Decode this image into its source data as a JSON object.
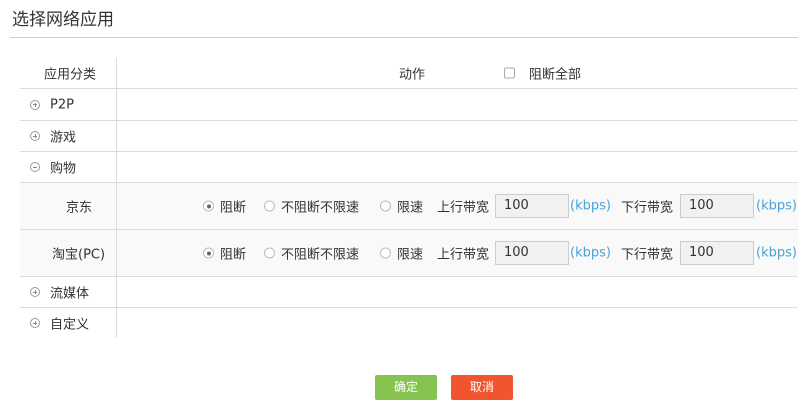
{
  "page": {
    "title": "选择网络应用"
  },
  "table": {
    "header": {
      "category": "应用分类",
      "action": "动作",
      "block_all_label": "阻断全部",
      "block_all_checked": false
    },
    "categories": [
      {
        "label": "P2P",
        "expanded": false
      },
      {
        "label": "游戏",
        "expanded": false
      },
      {
        "label": "购物",
        "expanded": true
      },
      {
        "label": "流媒体",
        "expanded": false
      },
      {
        "label": "自定义",
        "expanded": false
      }
    ],
    "shopping_apps": [
      {
        "name": "京东",
        "options": [
          "阻断",
          "不阻断不限速",
          "限速"
        ],
        "selected": "阻断",
        "upload_label": "上行带宽",
        "upload_value": "100",
        "download_label": "下行带宽",
        "download_value": "100",
        "unit": "(kbps)"
      },
      {
        "name": "淘宝(PC)",
        "options": [
          "阻断",
          "不阻断不限速",
          "限速"
        ],
        "selected": "阻断",
        "upload_label": "上行带宽",
        "upload_value": "100",
        "download_label": "下行带宽",
        "download_value": "100",
        "unit": "(kbps)"
      }
    ]
  },
  "buttons": {
    "ok": "确定",
    "cancel": "取消"
  },
  "colors": {
    "ok": "#86c350",
    "cancel": "#f1552f",
    "unit": "#4aa3d6"
  }
}
